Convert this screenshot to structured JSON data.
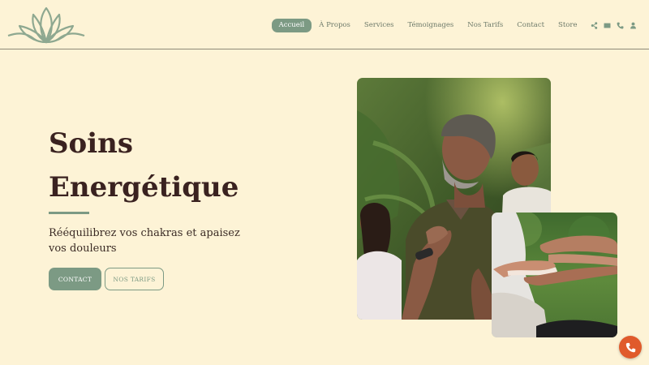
{
  "colors": {
    "background": "#fdf3d6",
    "accent": "#7c9a84",
    "heading": "#3a2220",
    "call_button": "#e05a2b"
  },
  "logo": {
    "icon": "lotus-icon"
  },
  "nav": {
    "items": [
      {
        "label": "Accueil",
        "active": true
      },
      {
        "label": "À Propos"
      },
      {
        "label": "Services"
      },
      {
        "label": "Témoignages"
      },
      {
        "label": "Nos Tarifs"
      },
      {
        "label": "Contact"
      },
      {
        "label": "Store"
      }
    ],
    "icons": [
      "share-icon",
      "envelope-icon",
      "phone-icon",
      "user-icon"
    ]
  },
  "hero": {
    "title_line1": "Soins",
    "title_line2": "Energétique",
    "subtitle": "Rééquilibrez vos chakras et apaisez vos douleurs",
    "contact_button": "CONTACT",
    "tarifs_button": "NOS TARIFS"
  },
  "images": {
    "main": "meditation-outdoor-photo",
    "secondary": "energy-healing-hands-photo"
  },
  "floating": {
    "icon": "phone-icon"
  }
}
